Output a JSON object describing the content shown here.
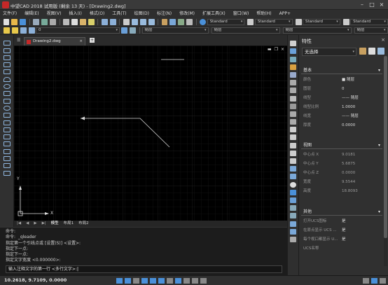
{
  "window": {
    "title": "中望CAD 2018 试用版 (剩余 13 天) - [Drawing2.dwg]"
  },
  "menu": [
    "文件(F)",
    "编辑(E)",
    "视图(V)",
    "插入(I)",
    "格式(O)",
    "工具(T)",
    "绘图(D)",
    "标注(N)",
    "修改(M)",
    "扩展工具(X)",
    "窗口(W)",
    "帮助(H)",
    "APP+"
  ],
  "toolbar": {
    "text_style": "Standard",
    "dim_style": "Standard",
    "table_style": "Standard",
    "multileader_style": "Standard",
    "layer": "0",
    "color": "随层",
    "linetype": "随层",
    "lineweight": "随层",
    "plot_style": "随层"
  },
  "document": {
    "tab_label": "Drawing2.dwg",
    "add_tab": "+",
    "model_tab": "模型",
    "layout1": "布局1",
    "layout2": "布局2"
  },
  "canvas": {
    "axis_x": "X",
    "axis_y": "Y",
    "close_symbol": "×",
    "min_symbol": "▬",
    "restore_symbol": "❐"
  },
  "command_history": [
    "命令:",
    "命令:  _qleader",
    "指定第一个引线点或 [设置(S)] <设置>:",
    "指定下一点:",
    "指定下一点:",
    "指定文字宽度 <0.000000>:"
  ],
  "command_prompt": "输入注释文字的第一行 <多行文字>:",
  "properties": {
    "title": "特性",
    "close": "×",
    "selection": "无选择",
    "sections": {
      "basic": {
        "title": "基本",
        "rows": [
          {
            "label": "颜色",
            "value": "■ 随层"
          },
          {
            "label": "图层",
            "value": "0"
          },
          {
            "label": "线型",
            "value": "—— 随层"
          },
          {
            "label": "线型比例",
            "value": "1.0000"
          },
          {
            "label": "线宽",
            "value": "—— 随层"
          },
          {
            "label": "厚度",
            "value": "0.0000"
          }
        ]
      },
      "view": {
        "title": "视图",
        "rows": [
          {
            "label": "中心点 X",
            "value": "9.0181"
          },
          {
            "label": "中心点 Y",
            "value": "5.6875"
          },
          {
            "label": "中心点 Z",
            "value": "0.0000"
          },
          {
            "label": "宽度",
            "value": "9.5544"
          },
          {
            "label": "高度",
            "value": "18.8093"
          }
        ]
      },
      "misc": {
        "title": "其他",
        "rows": [
          {
            "label": "打开UCS图标",
            "value": "是"
          },
          {
            "label": "在原点显示 UCS ...",
            "value": "是"
          },
          {
            "label": "每个视口都显示 U...",
            "value": "是"
          },
          {
            "label": "UCS名称",
            "value": ""
          }
        ]
      }
    }
  },
  "status": {
    "coordinates": "10.2618, 9.7109, 0.0000"
  },
  "colors": {
    "accent_blue": "#4a90d9",
    "brand_red": "#c62828",
    "canvas_bg": "#000000"
  }
}
